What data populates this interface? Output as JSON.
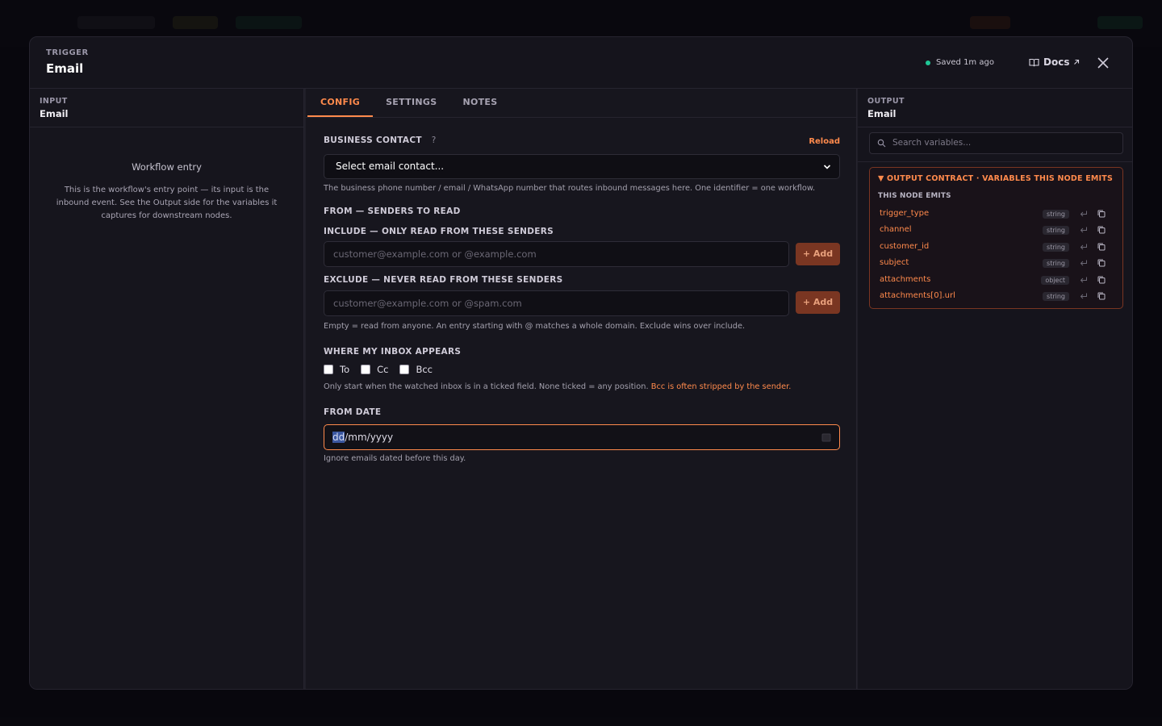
{
  "modal": {
    "kicker": "TRIGGER",
    "title": "Email",
    "saved_status": "Saved 1m ago",
    "docs_label": "Docs",
    "close_icon": "close-icon"
  },
  "input_panel": {
    "kicker": "INPUT",
    "title": "Email",
    "entry_title": "Workflow entry",
    "entry_desc": "This is the workflow's entry point — its input is the inbound event. See the Output side for the variables it captures for downstream nodes."
  },
  "tabs": [
    "CONFIG",
    "SETTINGS",
    "NOTES"
  ],
  "config": {
    "business_contact_label": "BUSINESS CONTACT",
    "business_contact_help_icon": "?",
    "reload_label": "Reload",
    "contact_select_value": "Select email contact...",
    "contact_help": "The business phone number / email / WhatsApp number that routes inbound messages here. One identifier = one workflow.",
    "from_label": "FROM — SENDERS TO READ",
    "include_label": "INCLUDE — ONLY READ FROM THESE SENDERS",
    "include_placeholder": "customer@example.com or @example.com",
    "include_add": "+ Add",
    "exclude_label": "EXCLUDE — NEVER READ FROM THESE SENDERS",
    "exclude_placeholder": "customer@example.com or @spam.com",
    "exclude_add": "+ Add",
    "senders_help": "Empty = read from anyone. An entry starting with @ matches a whole domain. Exclude wins over include.",
    "inbox_label": "WHERE MY INBOX APPEARS",
    "inbox_options": [
      "To",
      "Cc",
      "Bcc"
    ],
    "inbox_help": "Only start when the watched inbox is in a ticked field. None ticked = any position.",
    "inbox_warn": "Bcc is often stripped by the sender.",
    "from_date_label": "FROM DATE",
    "date_day": "dd",
    "date_rest": "/mm/yyyy",
    "date_help": "Ignore emails dated before this day."
  },
  "output_panel": {
    "kicker": "OUTPUT",
    "title": "Email",
    "search_placeholder": "Search variables...",
    "contract_header": "▼ OUTPUT CONTRACT · VARIABLES THIS NODE EMITS",
    "contract_sub": "THIS NODE EMITS",
    "variables": [
      {
        "name": "trigger_type",
        "type": "string"
      },
      {
        "name": "channel",
        "type": "string"
      },
      {
        "name": "customer_id",
        "type": "string"
      },
      {
        "name": "subject",
        "type": "string"
      },
      {
        "name": "attachments",
        "type": "object"
      },
      {
        "name": "attachments[0].url",
        "type": "string"
      }
    ]
  },
  "colors": {
    "accent": "#ff8a4c",
    "saved_dot": "#1fc796",
    "add_button": "#7a3622"
  }
}
